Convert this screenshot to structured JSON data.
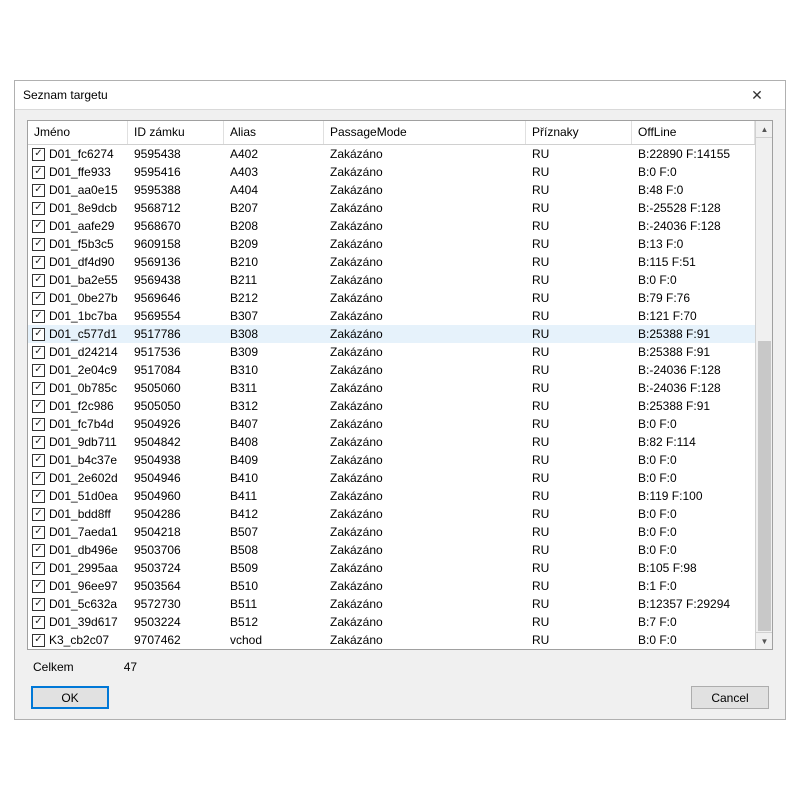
{
  "window": {
    "title": "Seznam targetu"
  },
  "columns": [
    "Jméno",
    "ID zámku",
    "Alias",
    "PassageMode",
    "Příznaky",
    "OffLine"
  ],
  "selected_index": 10,
  "rows": [
    {
      "checked": true,
      "name": "D01_fc6274",
      "lock_id": "9595438",
      "alias": "A402",
      "passage": "Zakázáno",
      "flags": "RU",
      "offline": "B:22890 F:14155"
    },
    {
      "checked": true,
      "name": "D01_ffe933",
      "lock_id": "9595416",
      "alias": "A403",
      "passage": "Zakázáno",
      "flags": "RU",
      "offline": "B:0 F:0"
    },
    {
      "checked": true,
      "name": "D01_aa0e15",
      "lock_id": "9595388",
      "alias": "A404",
      "passage": "Zakázáno",
      "flags": "RU",
      "offline": "B:48 F:0"
    },
    {
      "checked": true,
      "name": "D01_8e9dcb",
      "lock_id": "9568712",
      "alias": "B207",
      "passage": "Zakázáno",
      "flags": "RU",
      "offline": "B:-25528 F:128"
    },
    {
      "checked": true,
      "name": "D01_aafe29",
      "lock_id": "9568670",
      "alias": "B208",
      "passage": "Zakázáno",
      "flags": "RU",
      "offline": "B:-24036 F:128"
    },
    {
      "checked": true,
      "name": "D01_f5b3c5",
      "lock_id": "9609158",
      "alias": "B209",
      "passage": "Zakázáno",
      "flags": "RU",
      "offline": "B:13 F:0"
    },
    {
      "checked": true,
      "name": "D01_df4d90",
      "lock_id": "9569136",
      "alias": "B210",
      "passage": "Zakázáno",
      "flags": "RU",
      "offline": "B:115 F:51"
    },
    {
      "checked": true,
      "name": "D01_ba2e55",
      "lock_id": "9569438",
      "alias": "B211",
      "passage": "Zakázáno",
      "flags": "RU",
      "offline": "B:0 F:0"
    },
    {
      "checked": true,
      "name": "D01_0be27b",
      "lock_id": "9569646",
      "alias": "B212",
      "passage": "Zakázáno",
      "flags": "RU",
      "offline": "B:79 F:76"
    },
    {
      "checked": true,
      "name": "D01_1bc7ba",
      "lock_id": "9569554",
      "alias": "B307",
      "passage": "Zakázáno",
      "flags": "RU",
      "offline": "B:121 F:70"
    },
    {
      "checked": true,
      "name": "D01_c577d1",
      "lock_id": "9517786",
      "alias": "B308",
      "passage": "Zakázáno",
      "flags": "RU",
      "offline": "B:25388 F:91"
    },
    {
      "checked": true,
      "name": "D01_d24214",
      "lock_id": "9517536",
      "alias": "B309",
      "passage": "Zakázáno",
      "flags": "RU",
      "offline": "B:25388 F:91"
    },
    {
      "checked": true,
      "name": "D01_2e04c9",
      "lock_id": "9517084",
      "alias": "B310",
      "passage": "Zakázáno",
      "flags": "RU",
      "offline": "B:-24036 F:128"
    },
    {
      "checked": true,
      "name": "D01_0b785c",
      "lock_id": "9505060",
      "alias": "B311",
      "passage": "Zakázáno",
      "flags": "RU",
      "offline": "B:-24036 F:128"
    },
    {
      "checked": true,
      "name": "D01_f2c986",
      "lock_id": "9505050",
      "alias": "B312",
      "passage": "Zakázáno",
      "flags": "RU",
      "offline": "B:25388 F:91"
    },
    {
      "checked": true,
      "name": "D01_fc7b4d",
      "lock_id": "9504926",
      "alias": "B407",
      "passage": "Zakázáno",
      "flags": "RU",
      "offline": "B:0 F:0"
    },
    {
      "checked": true,
      "name": "D01_9db711",
      "lock_id": "9504842",
      "alias": "B408",
      "passage": "Zakázáno",
      "flags": "RU",
      "offline": "B:82 F:114"
    },
    {
      "checked": true,
      "name": "D01_b4c37e",
      "lock_id": "9504938",
      "alias": "B409",
      "passage": "Zakázáno",
      "flags": "RU",
      "offline": "B:0 F:0"
    },
    {
      "checked": true,
      "name": "D01_2e602d",
      "lock_id": "9504946",
      "alias": "B410",
      "passage": "Zakázáno",
      "flags": "RU",
      "offline": "B:0 F:0"
    },
    {
      "checked": true,
      "name": "D01_51d0ea",
      "lock_id": "9504960",
      "alias": "B411",
      "passage": "Zakázáno",
      "flags": "RU",
      "offline": "B:119 F:100"
    },
    {
      "checked": true,
      "name": "D01_bdd8ff",
      "lock_id": "9504286",
      "alias": "B412",
      "passage": "Zakázáno",
      "flags": "RU",
      "offline": "B:0 F:0"
    },
    {
      "checked": true,
      "name": "D01_7aeda1",
      "lock_id": "9504218",
      "alias": "B507",
      "passage": "Zakázáno",
      "flags": "RU",
      "offline": "B:0 F:0"
    },
    {
      "checked": true,
      "name": "D01_db496e",
      "lock_id": "9503706",
      "alias": "B508",
      "passage": "Zakázáno",
      "flags": "RU",
      "offline": "B:0 F:0"
    },
    {
      "checked": true,
      "name": "D01_2995aa",
      "lock_id": "9503724",
      "alias": "B509",
      "passage": "Zakázáno",
      "flags": "RU",
      "offline": "B:105 F:98"
    },
    {
      "checked": true,
      "name": "D01_96ee97",
      "lock_id": "9503564",
      "alias": "B510",
      "passage": "Zakázáno",
      "flags": "RU",
      "offline": "B:1 F:0"
    },
    {
      "checked": true,
      "name": "D01_5c632a",
      "lock_id": "9572730",
      "alias": "B511",
      "passage": "Zakázáno",
      "flags": "RU",
      "offline": "B:12357 F:29294"
    },
    {
      "checked": true,
      "name": "D01_39d617",
      "lock_id": "9503224",
      "alias": "B512",
      "passage": "Zakázáno",
      "flags": "RU",
      "offline": "B:7 F:0"
    },
    {
      "checked": true,
      "name": "K3_cb2c07",
      "lock_id": "9707462",
      "alias": "vchod",
      "passage": "Zakázáno",
      "flags": "RU",
      "offline": "B:0 F:0"
    }
  ],
  "footer": {
    "total_label": "Celkem",
    "total_value": "47",
    "ok_label": "OK",
    "cancel_label": "Cancel"
  }
}
